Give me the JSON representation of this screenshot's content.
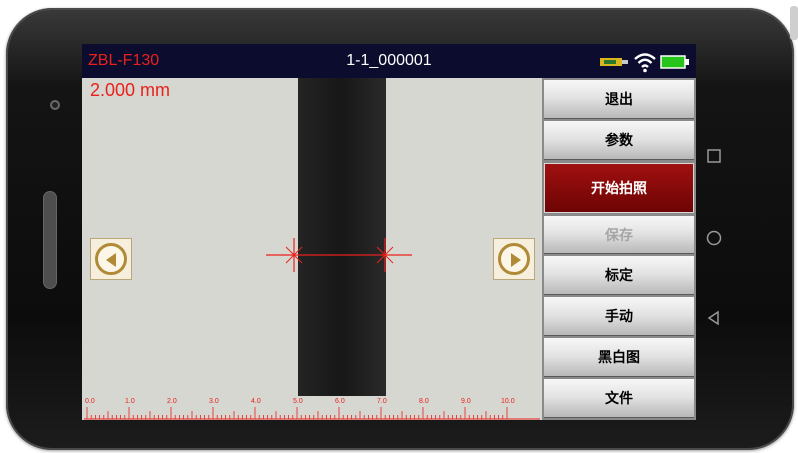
{
  "titlebar": {
    "left_text": "ZBL-F130",
    "center_text": "1-1_000001",
    "icons": [
      "usb-icon",
      "wifi-icon",
      "battery-icon"
    ]
  },
  "viewport": {
    "measurement": "2.000 mm"
  },
  "ruler": {
    "labels": [
      "0.0",
      "1.0",
      "2.0",
      "3.0",
      "4.0",
      "5.0",
      "6.0",
      "7.0",
      "8.0",
      "9.0",
      "10.0"
    ]
  },
  "sidebar": {
    "buttons": [
      {
        "label": "退出",
        "state": "normal"
      },
      {
        "label": "参数",
        "state": "normal"
      },
      {
        "label": "开始拍照",
        "state": "active"
      },
      {
        "label": "保存",
        "state": "disabled"
      },
      {
        "label": "标定",
        "state": "normal"
      },
      {
        "label": "手动",
        "state": "normal"
      },
      {
        "label": "黑白图",
        "state": "normal"
      },
      {
        "label": "文件",
        "state": "normal"
      }
    ]
  },
  "android_nav": [
    "recent-apps-icon",
    "home-icon",
    "back-icon"
  ],
  "colors": {
    "accent_red": "#e8211c",
    "active_button": "#8b0a0a",
    "titlebar_bg": "#0c0c2e"
  }
}
